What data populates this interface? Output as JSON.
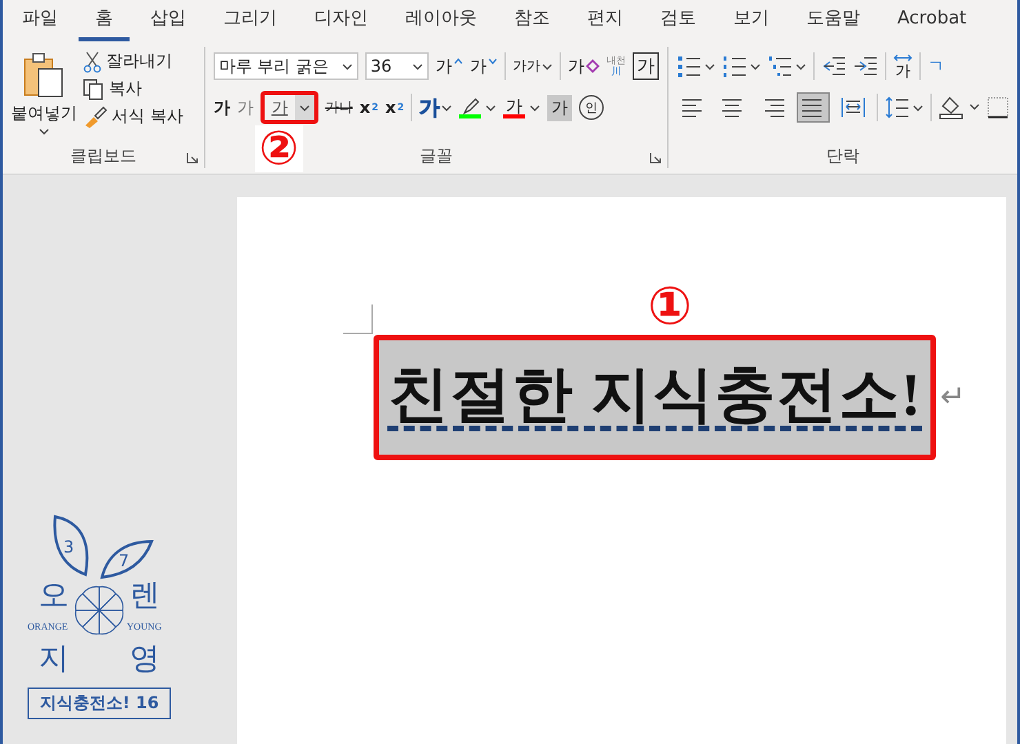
{
  "tabs": [
    {
      "label": "파일",
      "selected": false
    },
    {
      "label": "홈",
      "selected": true
    },
    {
      "label": "삽입",
      "selected": false
    },
    {
      "label": "그리기",
      "selected": false
    },
    {
      "label": "디자인",
      "selected": false
    },
    {
      "label": "레이아웃",
      "selected": false
    },
    {
      "label": "참조",
      "selected": false
    },
    {
      "label": "편지",
      "selected": false
    },
    {
      "label": "검토",
      "selected": false
    },
    {
      "label": "보기",
      "selected": false
    },
    {
      "label": "도움말",
      "selected": false
    },
    {
      "label": "Acrobat",
      "selected": false
    }
  ],
  "clipboard": {
    "paste": "붙여넣기",
    "cut": "잘라내기",
    "copy": "복사",
    "format_painter": "서식 복사",
    "label": "클립보드"
  },
  "font": {
    "name": "마루 부리 굵은",
    "size": "36",
    "grow": "가",
    "shrink": "가",
    "change_case": "가가",
    "clear_format": "가",
    "phonetic": [
      "내천",
      "川"
    ],
    "char_border": "가",
    "bold": "가",
    "italic": "가",
    "underline": {
      "glyph": "가",
      "selected": true
    },
    "strike": "가나",
    "subscript": [
      "x",
      "2"
    ],
    "superscript": [
      "x",
      "2"
    ],
    "text_effects": "가",
    "color_buttons": [
      {
        "kind": "highlight",
        "color": "#00ff00"
      },
      {
        "kind": "font-color",
        "glyph": "가",
        "color": "#ff0000"
      }
    ],
    "shading": "가",
    "enclose": "인",
    "label": "글꼴"
  },
  "paragraph": {
    "text_direction": "가",
    "sort": "ㄱ",
    "align": [
      {
        "kind": "left",
        "selected": false
      },
      {
        "kind": "center",
        "selected": false
      },
      {
        "kind": "right",
        "selected": false
      },
      {
        "kind": "justify",
        "selected": true
      },
      {
        "kind": "distributed",
        "selected": false
      }
    ],
    "label": "단락"
  },
  "callouts": [
    "①",
    "②"
  ],
  "document": {
    "title": "친절한 지식충전소!",
    "paragraph_mark": "↵"
  },
  "logo": {
    "leaf_marks": [
      "3",
      "7"
    ],
    "syllables": [
      "오",
      "렌",
      "지",
      "영"
    ],
    "words": [
      "ORANGE",
      "YOUNG"
    ],
    "caption": "지식충전소! 16"
  }
}
